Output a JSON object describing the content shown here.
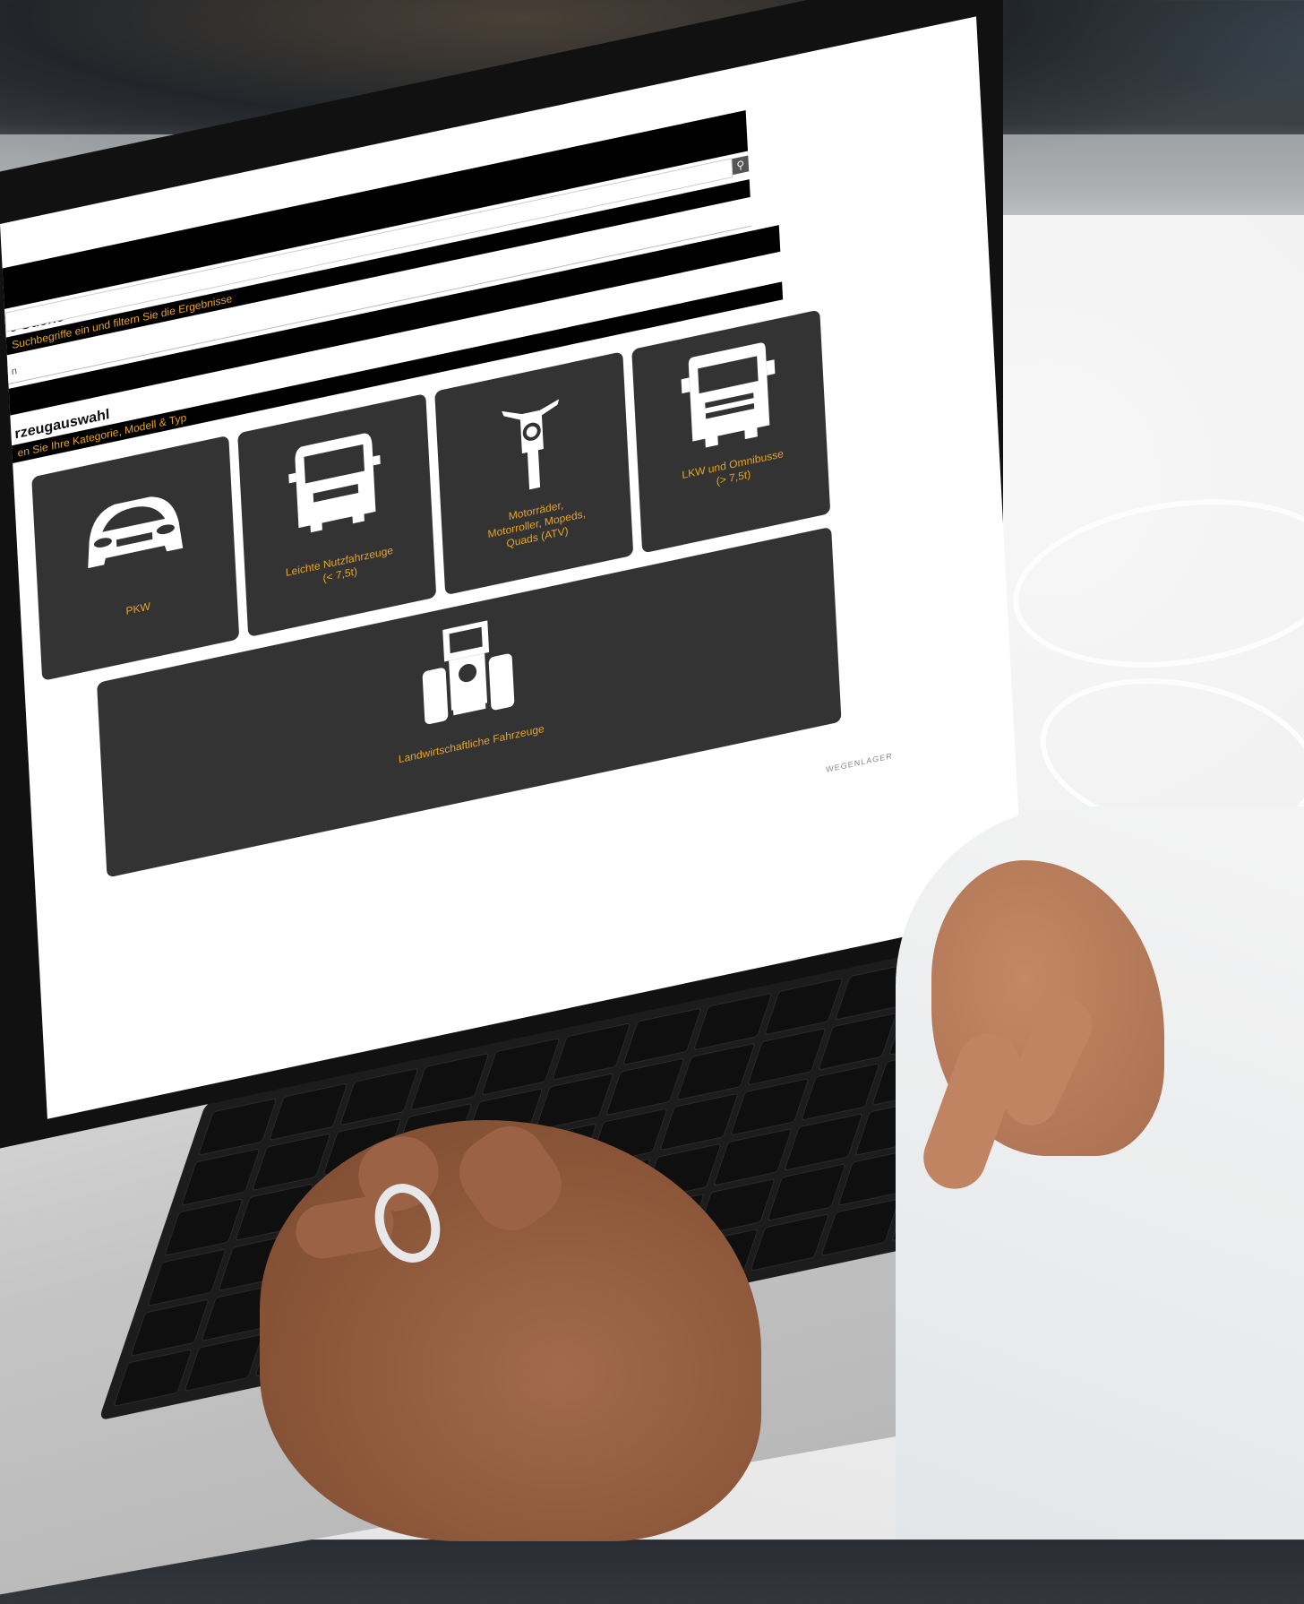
{
  "search": {
    "title": "e Suche",
    "subtitle": "Suchbegriffe ein und filtern Sie die Ergebnisse",
    "input_value": "n",
    "button_icon": "search-icon"
  },
  "vehicle_select": {
    "title": "rzeugauswahl",
    "subtitle": "en Sie Ihre Kategorie, Modell & Typ"
  },
  "tiles": [
    {
      "label": "PKW",
      "icon": "car-icon"
    },
    {
      "label": "Leichte Nutzfahrzeuge\n(< 7,5t)",
      "icon": "van-icon"
    },
    {
      "label": "Motorräder,\nMotorroller, Mopeds,\nQuads (ATV)",
      "icon": "motorcycle-icon"
    },
    {
      "label": "LKW und Omnibusse\n(> 7,5t)",
      "icon": "truck-icon"
    },
    {
      "label": "Landwirtschaftliche Fahrzeuge",
      "icon": "tractor-icon"
    }
  ],
  "footer": {
    "brand": "WEGENLAGER"
  },
  "colors": {
    "accent": "#e6a427",
    "tile": "#333333",
    "bar": "#000000"
  }
}
